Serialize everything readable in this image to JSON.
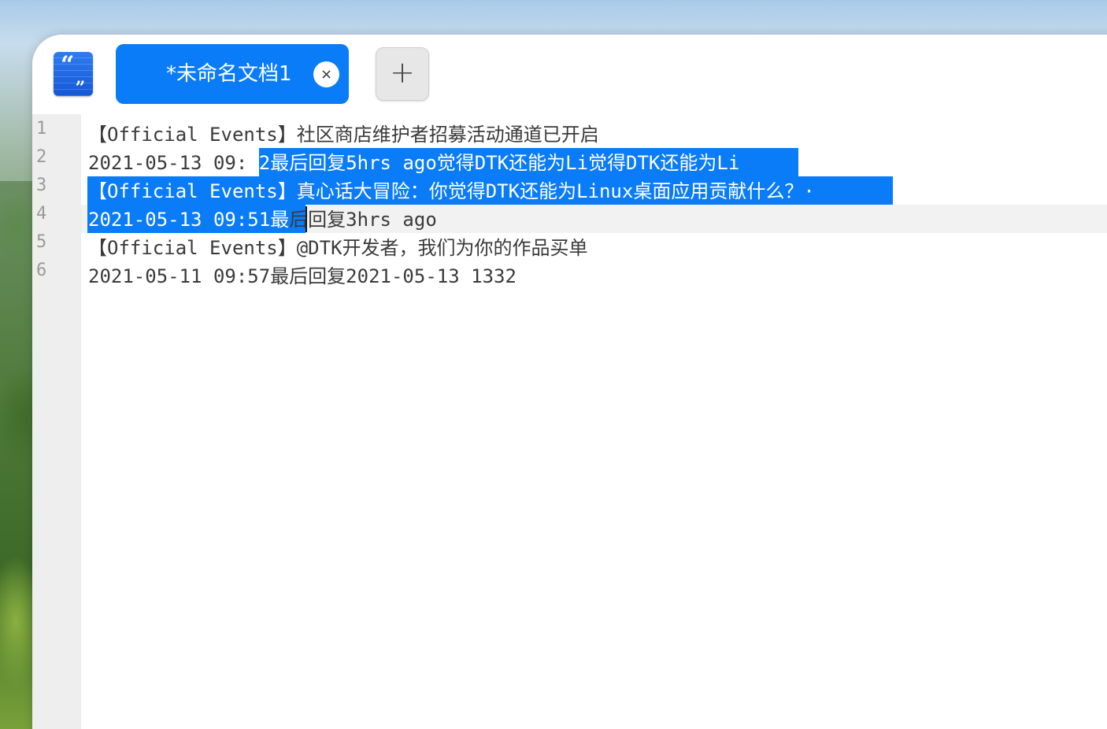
{
  "app": {
    "icon": "quote-document-icon",
    "accent_color": "#0a7cf7"
  },
  "tabs": [
    {
      "label": "*未命名文档1",
      "active": true,
      "close_icon": "×"
    }
  ],
  "new_tab": {
    "icon": "+"
  },
  "editor": {
    "line_numbers": [
      "1",
      "2",
      "3",
      "4",
      "5",
      "6"
    ],
    "current_line": 4,
    "lines": [
      {
        "text": "【Official Events】社区商店维护者招募活动通道已开启"
      },
      {
        "pre": "2021-05-13 09:",
        "sel": "52最后回复5hrs ago觉得DTK还能为Li觉得DTK还能为Li "
      },
      {
        "sel": "【Official Events】真心话大冒险：你觉得DTK还能为Linux桌面应用贡献什么？· "
      },
      {
        "sel": "2021-05-13 09:51最",
        "post": "后回复3hrs ago"
      },
      {
        "text": "【Official Events】@DTK开发者，我们为你的作品买单"
      },
      {
        "text": "2021-05-11 09:57最后回复2021-05-13 1332"
      }
    ]
  }
}
